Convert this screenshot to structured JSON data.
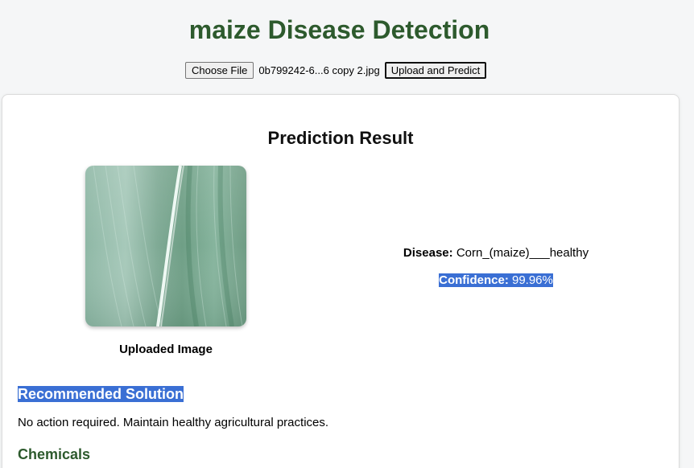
{
  "header": {
    "title": "maize Disease Detection"
  },
  "upload": {
    "choose_file_label": "Choose File",
    "file_name": "0b799242-6...6 copy 2.jpg",
    "upload_button_label": "Upload and Predict"
  },
  "result": {
    "title": "Prediction Result",
    "image_caption": "Uploaded Image",
    "disease_label": "Disease:",
    "disease_value": "Corn_(maize)___healthy",
    "confidence_label": "Confidence:",
    "confidence_value": "99.96%"
  },
  "solution": {
    "heading": "Recommended Solution",
    "text": "No action required. Maintain healthy agricultural practices."
  },
  "chemicals": {
    "heading": "Chemicals"
  },
  "colors": {
    "title_green": "#2d5a2d",
    "selection_blue": "#3a6fd4"
  }
}
